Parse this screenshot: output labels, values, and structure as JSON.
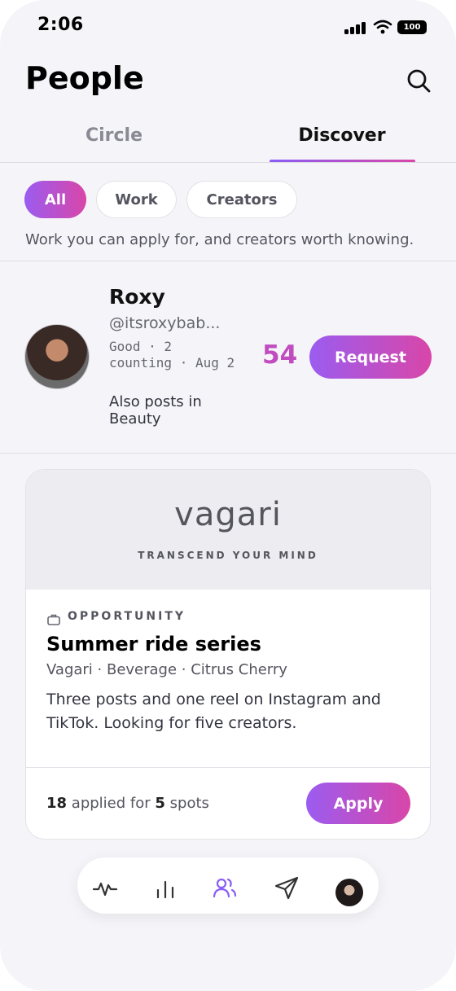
{
  "status_bar": {
    "time": "2:06",
    "battery": "100"
  },
  "header": {
    "title": "People"
  },
  "tabs": [
    {
      "label": "Circle",
      "active": false
    },
    {
      "label": "Discover",
      "active": true
    }
  ],
  "filters": {
    "chips": [
      "All",
      "Work",
      "Creators"
    ],
    "selected": "All",
    "description": "Work you can apply for, and creators worth knowing."
  },
  "person": {
    "name": "Roxy",
    "handle": "@itsroxybab...",
    "meta": "Good · 2 counting · Aug 2",
    "also_posts": "Also posts in Beauty",
    "score": "54",
    "action_label": "Request"
  },
  "opportunity": {
    "brand_logo": "vagari",
    "brand_tagline": "TRANSCEND YOUR MIND",
    "type_label": "OPPORTUNITY",
    "title": "Summer ride series",
    "subtitle": "Vagari · Beverage · Citrus Cherry",
    "description": "Three posts and one reel on Instagram and TikTok. Looking for five creators.",
    "applied_count": "18",
    "applied_text": "applied for",
    "spots_count": "5",
    "spots_text": "spots",
    "action_label": "Apply"
  },
  "bottom_nav": {
    "items": [
      "activity-icon",
      "stats-icon",
      "people-icon",
      "send-icon",
      "profile-avatar"
    ],
    "active": "people-icon"
  },
  "colors": {
    "accent_start": "#9b5cf0",
    "accent_end": "#d946a8",
    "score": "#c04cc0"
  }
}
